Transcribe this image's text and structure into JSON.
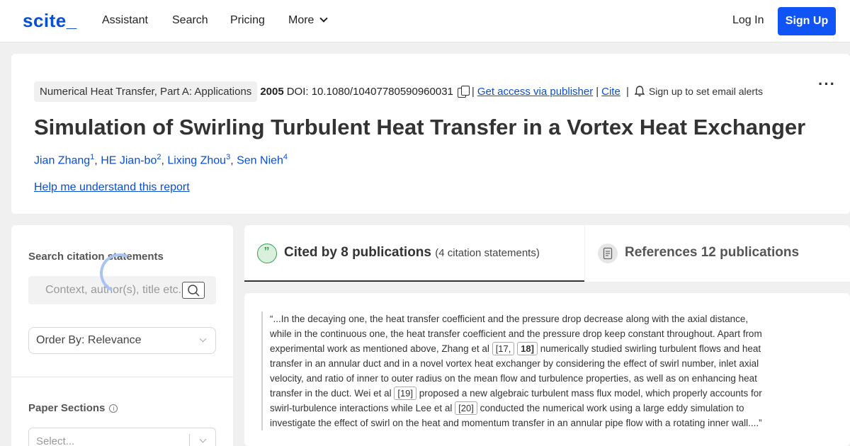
{
  "nav": {
    "logo": "scite_",
    "links": [
      "Assistant",
      "Search",
      "Pricing",
      "More"
    ],
    "login": "Log In",
    "signup": "Sign Up"
  },
  "paper": {
    "journal": "Numerical Heat Transfer, Part A: Applications",
    "year": "2005",
    "doi": "DOI: 10.1080/10407780590960031",
    "access_link": "Get access via publisher",
    "cite_link": "Cite",
    "alerts": "Sign up to set email alerts",
    "title": "Simulation of Swirling Turbulent Heat Transfer in a Vortex Heat Exchanger",
    "authors": [
      {
        "name": "Jian Zhang",
        "sup": "1"
      },
      {
        "name": "HE Jian-bo",
        "sup": "2"
      },
      {
        "name": "Lixing Zhou",
        "sup": "3"
      },
      {
        "name": "Sen Nieh",
        "sup": "4"
      }
    ],
    "help_link": "Help me understand this report"
  },
  "sidebar": {
    "search_label": "Search citation statements",
    "search_placeholder": "Context, author(s), title etc.",
    "order_by": "Order By: Relevance",
    "sections_label": "Paper Sections",
    "sections_placeholder": "Select..."
  },
  "tabs": {
    "cited_main": "Cited by 8 publications",
    "cited_sub": "(4 citation statements)",
    "references": "References 12 publications"
  },
  "citation": {
    "t1": "“...In the decaying one, the heat transfer coefficient and the pressure drop decrease along with the axial distance, while in the continuous one, the heat transfer coefficient and the pressure drop keep constant throughout. Apart from experimental work as mentioned above, Zhang et al ",
    "r1": "[17,",
    "r2": "18]",
    "t2": " numerically studied swirling turbulent flows and heat transfer in an annular duct and in a novel vortex heat exchanger by considering the effect of swirl number, inlet axial velocity, and ratio of inner to outer radius on the mean flow and turbulence properties, as well as on enhancing heat transfer in the duct. Wei et al ",
    "r3": "[19]",
    "t3": " proposed a new algebraic turbulent mass flux model, which properly accounts for swirl-turbulence interactions while Lee et al ",
    "r4": "[20]",
    "t4": " conducted the numerical work using a large eddy simulation to investigate the effect of swirl on the heat and momentum transfer in an annular pipe flow with a rotating inner wall....”"
  }
}
